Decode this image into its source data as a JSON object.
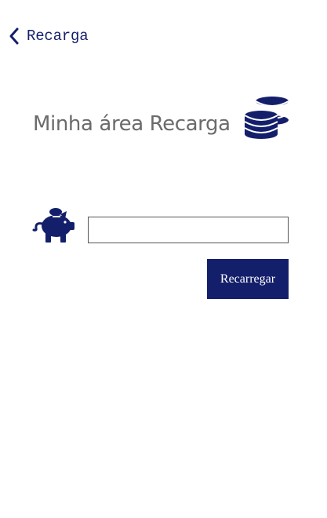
{
  "header": {
    "back_icon": "chevron-left-icon",
    "title": "Recarga"
  },
  "main": {
    "title": "Minha área Recarga",
    "title_icon": "coins-stack-icon",
    "amount_icon": "piggy-bank-icon",
    "amount_input": {
      "value": "",
      "placeholder": ""
    },
    "recharge_button_label": "Recarregar"
  },
  "colors": {
    "accent": "#141f6b",
    "title_text": "#6b6b6b",
    "background": "#ffffff"
  }
}
